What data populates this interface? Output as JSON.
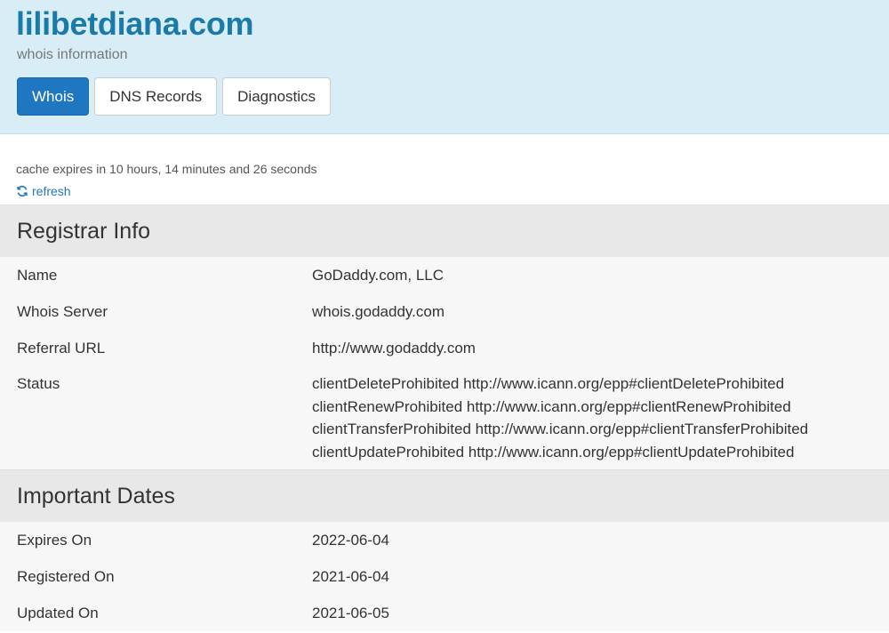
{
  "header": {
    "domain": "lilibetdiana.com",
    "subtitle": "whois information",
    "tabs": [
      {
        "label": "Whois",
        "active": true
      },
      {
        "label": "DNS Records",
        "active": false
      },
      {
        "label": "Diagnostics",
        "active": false
      }
    ]
  },
  "cache": {
    "text": "cache expires in 10 hours, 14 minutes and 26 seconds",
    "refresh_label": "refresh",
    "refresh_icon": "refresh-icon"
  },
  "registrar": {
    "heading": "Registrar Info",
    "rows": [
      {
        "label": "Name",
        "value": "GoDaddy.com, LLC"
      },
      {
        "label": "Whois Server",
        "value": "whois.godaddy.com"
      },
      {
        "label": "Referral URL",
        "value": "http://www.godaddy.com"
      }
    ],
    "status": {
      "label": "Status",
      "values": [
        "clientDeleteProhibited http://www.icann.org/epp#clientDeleteProhibited",
        "clientRenewProhibited http://www.icann.org/epp#clientRenewProhibited",
        "clientTransferProhibited http://www.icann.org/epp#clientTransferProhibited",
        "clientUpdateProhibited http://www.icann.org/epp#clientUpdateProhibited"
      ]
    }
  },
  "dates": {
    "heading": "Important Dates",
    "rows": [
      {
        "label": "Expires On",
        "value": "2022-06-04"
      },
      {
        "label": "Registered On",
        "value": "2021-06-04"
      },
      {
        "label": "Updated On",
        "value": "2021-06-05"
      }
    ]
  },
  "colors": {
    "header_bg": "#d9edf7",
    "title": "#1a7aa8",
    "accent": "#1f77c1",
    "section_head_bg": "#e8e8e8",
    "row_bg": "#f7f7f7"
  }
}
